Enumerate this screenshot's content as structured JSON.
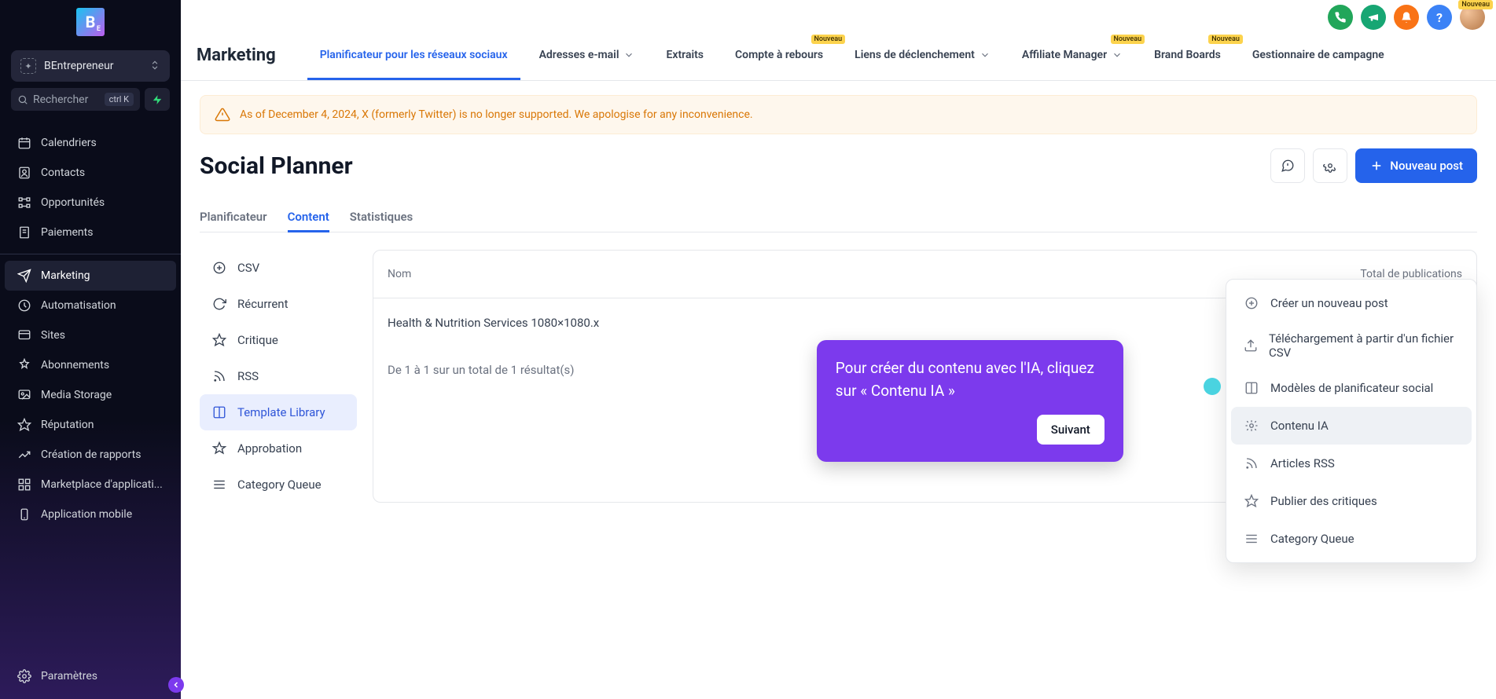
{
  "sidebar": {
    "org_name": "BEntrepreneur",
    "search_placeholder": "Rechercher",
    "search_kbd": "ctrl K",
    "nav": [
      {
        "id": "calendars",
        "label": "Calendriers"
      },
      {
        "id": "contacts",
        "label": "Contacts"
      },
      {
        "id": "opportunities",
        "label": "Opportunités"
      },
      {
        "id": "payments",
        "label": "Paiements"
      },
      {
        "id": "marketing",
        "label": "Marketing",
        "active": true
      },
      {
        "id": "automation",
        "label": "Automatisation"
      },
      {
        "id": "sites",
        "label": "Sites"
      },
      {
        "id": "subscriptions",
        "label": "Abonnements"
      },
      {
        "id": "media",
        "label": "Media Storage"
      },
      {
        "id": "reputation",
        "label": "Réputation"
      },
      {
        "id": "reports",
        "label": "Création de rapports"
      },
      {
        "id": "marketplace",
        "label": "Marketplace d'applicati..."
      },
      {
        "id": "mobile",
        "label": "Application mobile"
      }
    ],
    "settings_label": "Paramètres"
  },
  "header": {
    "section": "Marketing",
    "tabs": [
      {
        "id": "social",
        "label": "Planificateur pour les réseaux sociaux",
        "active": true
      },
      {
        "id": "email",
        "label": "Adresses e-mail",
        "chevron": true
      },
      {
        "id": "snippets",
        "label": "Extraits"
      },
      {
        "id": "countdown",
        "label": "Compte à rebours",
        "nouveau": true
      },
      {
        "id": "triggers",
        "label": "Liens de déclenchement",
        "chevron": true
      },
      {
        "id": "affiliate",
        "label": "Affiliate Manager",
        "chevron": true,
        "nouveau": true
      },
      {
        "id": "brand",
        "label": "Brand Boards",
        "nouveau": true
      },
      {
        "id": "campaign",
        "label": "Gestionnaire de campagne"
      }
    ],
    "nouveau_chip": "Nouveau"
  },
  "alert_text": "As of December 4, 2024, X (formerly Twitter) is no longer supported. We apologise for any inconvenience.",
  "page_title": "Social Planner",
  "new_post_label": "Nouveau post",
  "subtabs": [
    {
      "id": "planner",
      "label": "Planificateur"
    },
    {
      "id": "content",
      "label": "Content",
      "active": true
    },
    {
      "id": "stats",
      "label": "Statistiques"
    }
  ],
  "left_menu": [
    {
      "id": "csv",
      "label": "CSV"
    },
    {
      "id": "recurring",
      "label": "Récurrent"
    },
    {
      "id": "review",
      "label": "Critique"
    },
    {
      "id": "rss",
      "label": "RSS"
    },
    {
      "id": "template",
      "label": "Template Library",
      "active": true
    },
    {
      "id": "approval",
      "label": "Approbation"
    },
    {
      "id": "catqueue",
      "label": "Category Queue"
    }
  ],
  "table": {
    "col_nom": "Nom",
    "col_total": "Total de publications",
    "row_name": "Health & Nutrition Services 1080×1080.x",
    "footer": "De 1 à 1 sur un total de 1 résultat(s)"
  },
  "dropdown": [
    {
      "id": "new",
      "label": "Créer un nouveau post"
    },
    {
      "id": "csvup",
      "label": "Téléchargement à partir d'un fichier CSV"
    },
    {
      "id": "templates",
      "label": "Modèles de planificateur social"
    },
    {
      "id": "ai",
      "label": "Contenu IA",
      "highlight": true
    },
    {
      "id": "rss",
      "label": "Articles RSS"
    },
    {
      "id": "reviews",
      "label": "Publier des critiques"
    },
    {
      "id": "cq",
      "label": "Category Queue"
    }
  ],
  "tour": {
    "text": "Pour créer du contenu avec l'IA, cliquez sur « Contenu IA »",
    "button": "Suivant"
  }
}
